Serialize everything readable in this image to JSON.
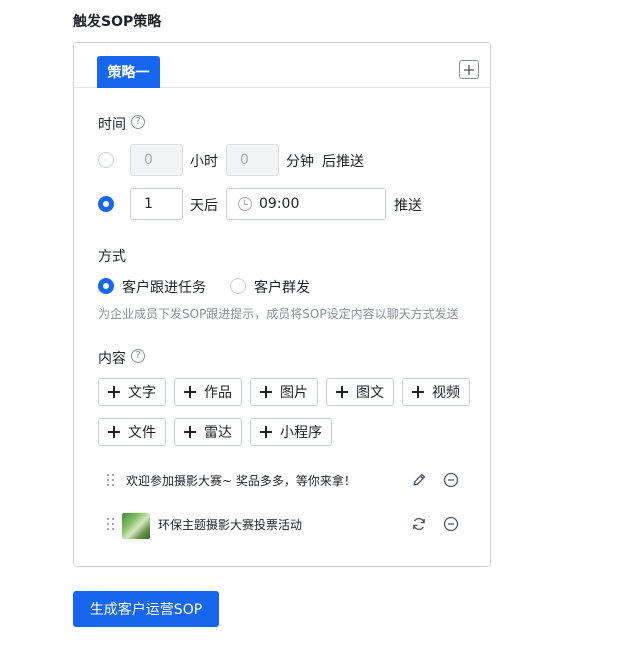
{
  "title": "触发SOP策略",
  "tabs": [
    {
      "label": "策略一",
      "active": true
    }
  ],
  "time": {
    "label": "时间",
    "option1": {
      "hours_value": "0",
      "hours_unit": "小时",
      "minutes_value": "0",
      "minutes_unit": "分钟",
      "suffix": "后推送",
      "selected": false
    },
    "option2": {
      "days_value": "1",
      "days_unit": "天后",
      "time_value": "09:00",
      "suffix": "推送",
      "selected": true
    }
  },
  "method": {
    "label": "方式",
    "options": [
      {
        "label": "客户跟进任务",
        "selected": true
      },
      {
        "label": "客户群发",
        "selected": false
      }
    ],
    "hint": "为企业成员下发SOP跟进提示，成员将SOP设定内容以聊天方式发送"
  },
  "content": {
    "label": "内容",
    "add_buttons": [
      "文字",
      "作品",
      "图片",
      "图文",
      "视频",
      "文件",
      "雷达",
      "小程序"
    ],
    "items": [
      {
        "text": "欢迎参加摄影大赛~ 奖品多多，等你来拿！",
        "action_icon": "edit-icon",
        "remove_icon": "remove-icon"
      },
      {
        "text": "环保主题摄影大赛投票活动",
        "thumb": "image-thumbnail",
        "action_icon": "refresh-icon",
        "remove_icon": "remove-icon"
      }
    ]
  },
  "submit_label": "生成客户运营SOP",
  "colors": {
    "primary": "#1766f0",
    "border": "#d0d3d9",
    "hint": "#8a8f99"
  }
}
